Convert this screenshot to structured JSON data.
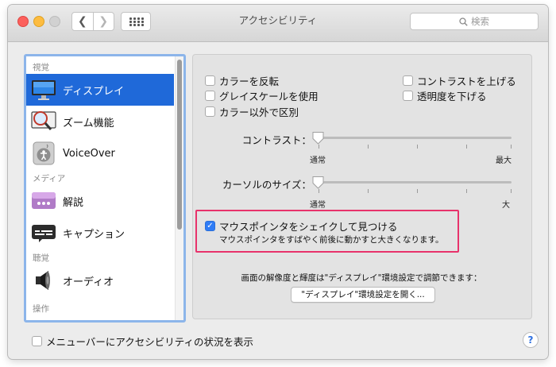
{
  "window": {
    "title": "アクセシビリティ",
    "search_placeholder": "検索"
  },
  "toolbar": {
    "back_icon": "chevron-left-icon",
    "forward_icon": "chevron-right-icon",
    "grid_icon": "grid-icon"
  },
  "sidebar": {
    "sections": [
      {
        "header": "視覚",
        "items": [
          {
            "label": "ディスプレイ",
            "icon": "display-icon",
            "selected": true
          },
          {
            "label": "ズーム機能",
            "icon": "zoom-icon"
          },
          {
            "label": "VoiceOver",
            "icon": "voiceover-icon"
          }
        ]
      },
      {
        "header": "メディア",
        "items": [
          {
            "label": "解説",
            "icon": "descriptions-icon"
          },
          {
            "label": "キャプション",
            "icon": "captions-icon"
          }
        ]
      },
      {
        "header": "聴覚",
        "items": [
          {
            "label": "オーディオ",
            "icon": "speaker-icon"
          }
        ]
      },
      {
        "header": "操作",
        "items": []
      }
    ]
  },
  "options": {
    "invert": {
      "label": "カラーを反転",
      "checked": false
    },
    "grayscale": {
      "label": "グレイスケールを使用",
      "checked": false
    },
    "diff_without_color": {
      "label": "カラー以外で区別",
      "checked": false
    },
    "increase_contrast": {
      "label": "コントラストを上げる",
      "checked": false
    },
    "reduce_transparency": {
      "label": "透明度を下げる",
      "checked": false
    }
  },
  "contrast_slider": {
    "label": "コントラスト：",
    "min_label": "通常",
    "max_label": "最大",
    "value": 0
  },
  "cursor_slider": {
    "label": "カーソルのサイズ：",
    "min_label": "通常",
    "max_label": "大",
    "value": 0
  },
  "shake": {
    "label": "マウスポインタをシェイクして見つける",
    "description": "マウスポインタをすばやく前後に動かすと大きくなります。",
    "checked": true
  },
  "display_note": "画面の解像度と輝度は\"ディスプレイ\"環境設定で調節できます：",
  "display_button": "\"ディスプレイ\"環境設定を開く...",
  "menubar_option": {
    "label": "メニューバーにアクセシビリティの状況を表示",
    "checked": false
  },
  "help_label": "?",
  "colors": {
    "selection": "#1f69d9",
    "checkbox_on": "#2f7cf6",
    "highlight_border": "#e8326b"
  }
}
